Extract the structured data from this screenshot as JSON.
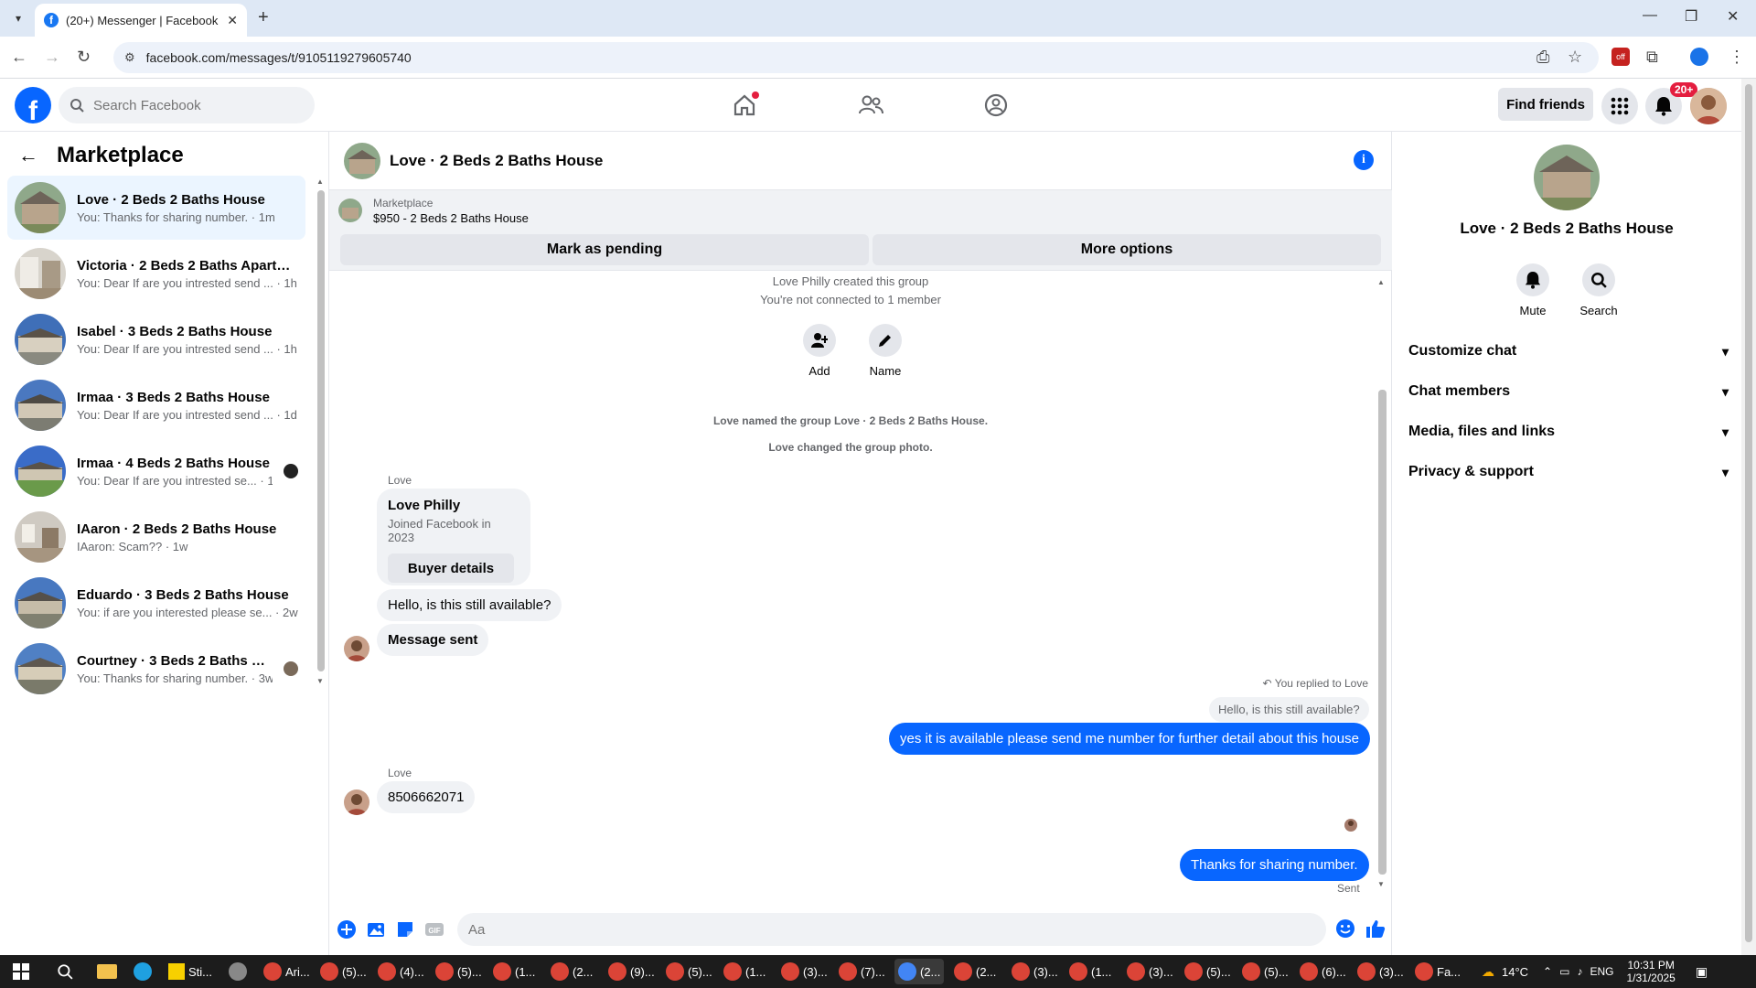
{
  "browser": {
    "tab_title": "(20+) Messenger | Facebook",
    "url": "facebook.com/messages/t/9105119279605740"
  },
  "fbnav": {
    "search_placeholder": "Search Facebook",
    "find_friends": "Find friends",
    "notif_badge": "20+"
  },
  "sidebar": {
    "title": "Marketplace",
    "conversations": [
      {
        "name": "Love · 2 Beds 2 Baths House",
        "preview": "You: Thanks for sharing number. · 1m",
        "active": true
      },
      {
        "name": "Victoria · 2 Beds 2 Baths Apartm...",
        "preview": "You: Dear If are you intrested send ... · 1h"
      },
      {
        "name": "Isabel · 3 Beds 2 Baths House",
        "preview": "You: Dear If are you intrested send ... · 1h"
      },
      {
        "name": "Irmaa · 3 Beds 2 Baths House",
        "preview": "You: Dear If are you intrested send ... · 1d"
      },
      {
        "name": "Irmaa · 4 Beds 2 Baths House",
        "preview": "You: Dear If are you intrested se... · 1w"
      },
      {
        "name": "IAaron · 2 Beds 2 Baths House",
        "preview": "IAaron: Scam?? · 1w"
      },
      {
        "name": "Eduardo · 3 Beds 2 Baths House",
        "preview": "You: if are you interested please se... · 2w"
      },
      {
        "name": "Courtney · 3 Beds 2 Baths Ho...",
        "preview": "You: Thanks for sharing number. · 3w"
      }
    ]
  },
  "chat": {
    "title": "Love · 2 Beds 2 Baths House",
    "marketplace_label": "Marketplace",
    "listing": "$950 - 2 Beds 2 Baths House",
    "mark_pending": "Mark as pending",
    "more_options": "More options",
    "sys_created": "Love Philly created this group",
    "sys_not_connected": "You're not connected to 1 member",
    "add_label": "Add",
    "name_label": "Name",
    "sys_named": "Love named the group Love · 2 Beds 2 Baths House.",
    "sys_photo": "Love changed the group photo.",
    "sender_love": "Love",
    "card_name": "Love Philly",
    "card_joined": "Joined Facebook in 2023",
    "card_button": "Buyer details",
    "msg_available": "Hello, is this still available?",
    "msg_sent": "Message sent",
    "replied_to": "You replied to Love",
    "replied_quote": "Hello, is this still available?",
    "msg_reply": "yes it is available please send me number for further detail about this house",
    "sender_love2": "Love",
    "msg_number": "8506662071",
    "msg_thanks": "Thanks for sharing number.",
    "sent_status": "Sent",
    "composer_placeholder": "Aa"
  },
  "rpanel": {
    "title": "Love · 2 Beds 2 Baths House",
    "mute": "Mute",
    "search": "Search",
    "items": [
      "Customize chat",
      "Chat members",
      "Media, files and links",
      "Privacy & support"
    ]
  },
  "taskbar": {
    "weather": "14°C",
    "lang": "ENG",
    "time": "10:31 PM",
    "date": "1/31/2025",
    "apps": [
      "Sti...",
      "Ari...",
      "(5)...",
      "(4)...",
      "(5)...",
      "(1...",
      "(2...",
      "(9)...",
      "(5)...",
      "(1...",
      "(3)...",
      "(7)...",
      "(2...",
      "(2...",
      "(3)...",
      "(1...",
      "(3)...",
      "(5)...",
      "(5)...",
      "(6)...",
      "(3)...",
      "Fa..."
    ]
  },
  "colors": {
    "fb_blue": "#0866ff",
    "bubble_in": "#f0f2f5",
    "badge_red": "#e41e3f"
  }
}
